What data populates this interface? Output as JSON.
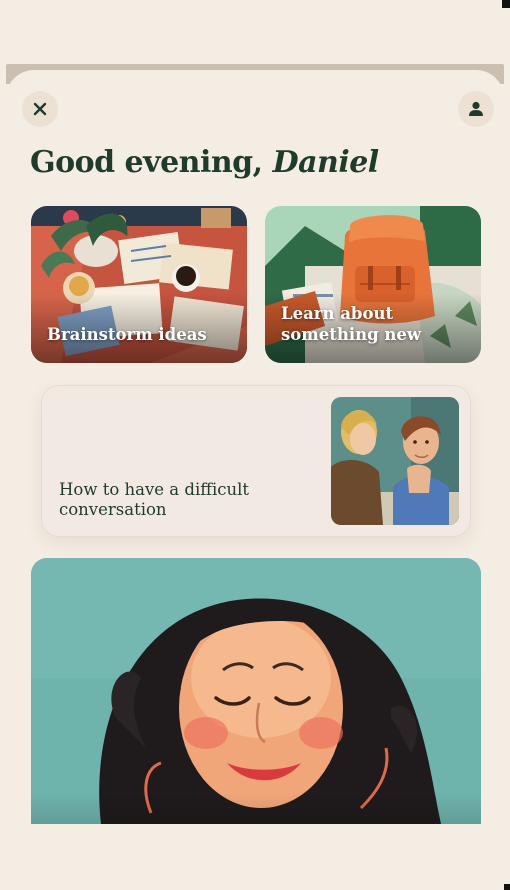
{
  "header": {
    "greeting": "Good evening,",
    "name": "Daniel"
  },
  "icons": {
    "close": "close-icon",
    "profile": "person-icon"
  },
  "cards": [
    {
      "label": "Brainstorm ideas"
    },
    {
      "label_line1": "Learn about",
      "label_line2": "something new"
    }
  ],
  "featured": {
    "line1": "How to have a difficult",
    "line2": "conversation"
  },
  "colors": {
    "background": "#f4ede3",
    "text_dark_green": "#1f3b2c",
    "hero_teal": "#6fb3ad"
  }
}
